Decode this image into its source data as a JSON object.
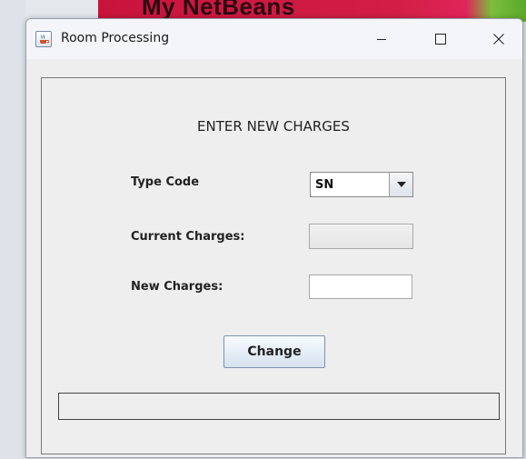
{
  "background": {
    "banner_text": "My NetBeans"
  },
  "window": {
    "title": "Room Processing",
    "icon": "java-coffee-icon",
    "controls": {
      "minimize_icon": "minimize-icon",
      "maximize_icon": "maximize-icon",
      "close_icon": "close-icon"
    }
  },
  "form": {
    "heading": "ENTER NEW CHARGES",
    "type_code": {
      "label": "Type Code",
      "selected": "SN"
    },
    "current_charges": {
      "label": "Current Charges:",
      "value": ""
    },
    "new_charges": {
      "label": "New Charges:",
      "value": ""
    },
    "change_button_label": "Change",
    "status_text": ""
  },
  "colors": {
    "banner": "#d21e46",
    "button_border": "#7e94ad",
    "panel_bg": "#eeeeee"
  }
}
